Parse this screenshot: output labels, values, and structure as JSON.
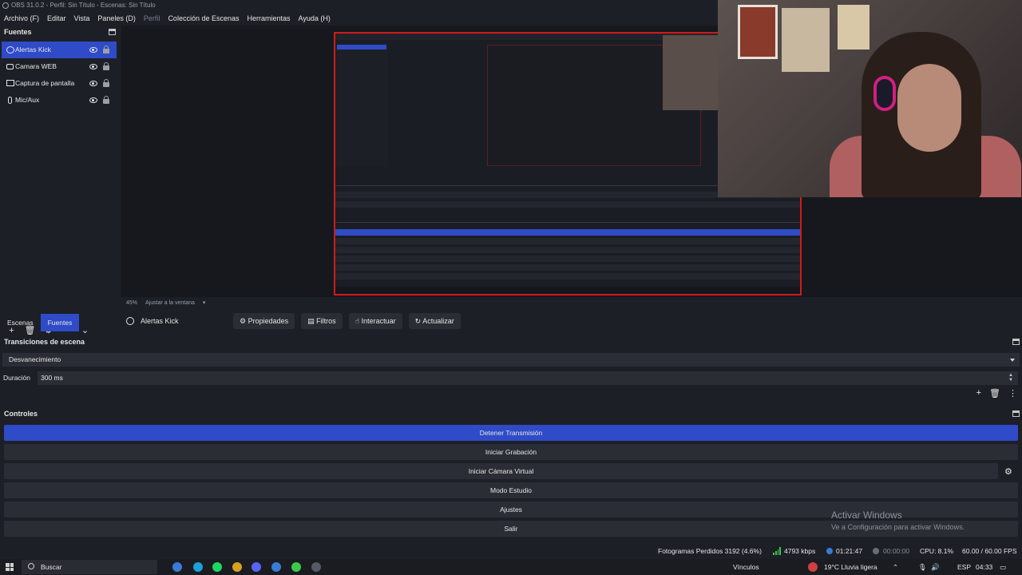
{
  "window": {
    "title": "OBS 31.0.2 - Perfil: Sin Título - Escenas: Sin Título"
  },
  "menu": {
    "items": [
      "Archivo (F)",
      "Editar",
      "Vista",
      "Paneles (D)",
      "Perfil",
      "Colección de Escenas",
      "Herramientas",
      "Ayuda (H)"
    ]
  },
  "sources_dock": {
    "title": "Fuentes",
    "items": [
      {
        "label": "Alertas Kick",
        "icon": "globe-icon",
        "selected": true
      },
      {
        "label": "Camara WEB",
        "icon": "camera-icon",
        "selected": false
      },
      {
        "label": "Captura de pantalla",
        "icon": "display-icon",
        "selected": false
      },
      {
        "label": "Mic/Aux",
        "icon": "mic-icon",
        "selected": false
      }
    ]
  },
  "preview": {
    "zoom": "45%",
    "fit_label": "Ajustar a la ventana"
  },
  "tabs": {
    "scenes": "Escenas",
    "sources": "Fuentes"
  },
  "context_bar": {
    "source_name": "Alertas Kick",
    "properties": "Propiedades",
    "filters": "Filtros",
    "interact": "Interactuar",
    "refresh": "Actualizar"
  },
  "transitions": {
    "title": "Transiciones de escena",
    "selected": "Desvanecimiento",
    "duration_label": "Duración",
    "duration_value": "300 ms"
  },
  "controls": {
    "title": "Controles",
    "stop_stream": "Detener Transmisión",
    "start_recording": "Iniciar Grabación",
    "start_vcam": "Iniciar Cámara Virtual",
    "studio_mode": "Modo Estudio",
    "settings": "Ajustes",
    "exit": "Salir"
  },
  "watermark": {
    "line1": "Activar Windows",
    "line2": "Ve a Configuración para activar Windows."
  },
  "status": {
    "dropped_frames": "Fotogramas Perdidos 3192 (4.6%)",
    "bitrate": "4793 kbps",
    "stream_time": "01:21:47",
    "rec_time": "00:00:00",
    "cpu": "CPU: 8.1%",
    "fps": "60.00 / 60.00 FPS"
  },
  "taskbar": {
    "search": "Buscar",
    "links": "Vínculos",
    "weather": "19°C  Lluvia ligera",
    "lang": "ESP",
    "time": "04:33"
  },
  "colors": {
    "accent": "#2f4bc8",
    "bg": "#1d1f26",
    "button": "#2a2d35",
    "preview_border": "#d21a1a"
  }
}
